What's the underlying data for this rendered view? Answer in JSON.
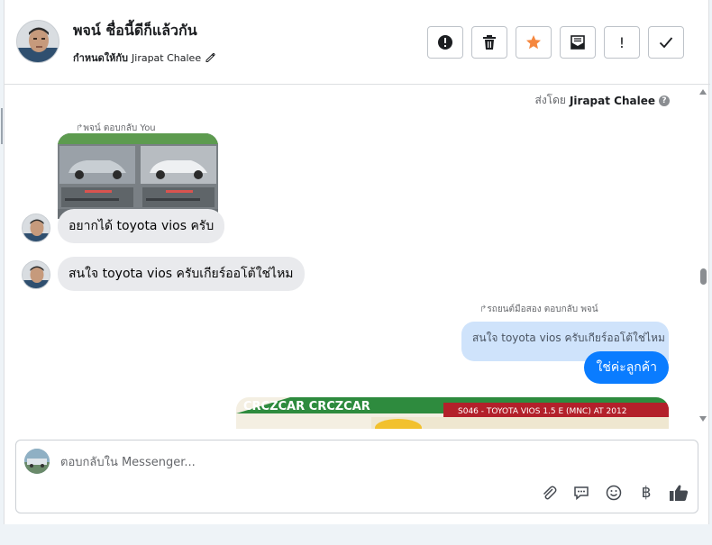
{
  "header": {
    "title": "พจน์ ชื่อนี้ดีก็แล้วกัน",
    "assigned_prefix": "กำหนดให้กับ",
    "assigned_name": "Jirapat Chalee",
    "actions": [
      {
        "name": "report-button",
        "icon": "alert-circle-icon"
      },
      {
        "name": "delete-button",
        "icon": "trash-icon"
      },
      {
        "name": "star-button",
        "icon": "star-icon",
        "color": "#f5873e"
      },
      {
        "name": "mark-unread-button",
        "icon": "envelope-icon"
      },
      {
        "name": "important-button",
        "icon": "exclamation-icon",
        "label": "!"
      },
      {
        "name": "done-button",
        "icon": "check-icon"
      }
    ]
  },
  "thread": {
    "sent_by_prefix": "ส่งโดย",
    "sent_by_name": "Jirapat Chalee",
    "reply_note_1": "พจน์ ตอบกลับ You",
    "msg_1": "อยากได้ toyota vios ครับ",
    "msg_2": "สนใจ toyota vios ครับเกียร์ออโต้ใช่ไหม",
    "reply_note_2": "รถยนต์มือสอง ตอบกลับ พจน์",
    "quoted_text": "สนใจ toyota vios ครับเกียร์ออโต้ใช่ไหม",
    "reply_text": "ใช่ค่ะลูกค้า",
    "image_banner": "S046 - TOYOTA VIOS 1.5 E (MNC) AT 2012",
    "image_brand": "CRCZCAR CRCZCAR"
  },
  "composer": {
    "placeholder": "ตอบกลับใน Messenger...",
    "tools": [
      {
        "name": "attach-icon",
        "glyph": ""
      },
      {
        "name": "saved-replies-icon",
        "glyph": ""
      },
      {
        "name": "emoji-icon",
        "glyph": ""
      },
      {
        "name": "payment-icon",
        "glyph": "฿"
      },
      {
        "name": "like-icon",
        "glyph": ""
      }
    ]
  },
  "colors": {
    "accent": "#0a7cff",
    "star": "#f5873e",
    "incoming_bubble": "#e9eaed",
    "quoted_bubble": "#cfe3fb"
  }
}
